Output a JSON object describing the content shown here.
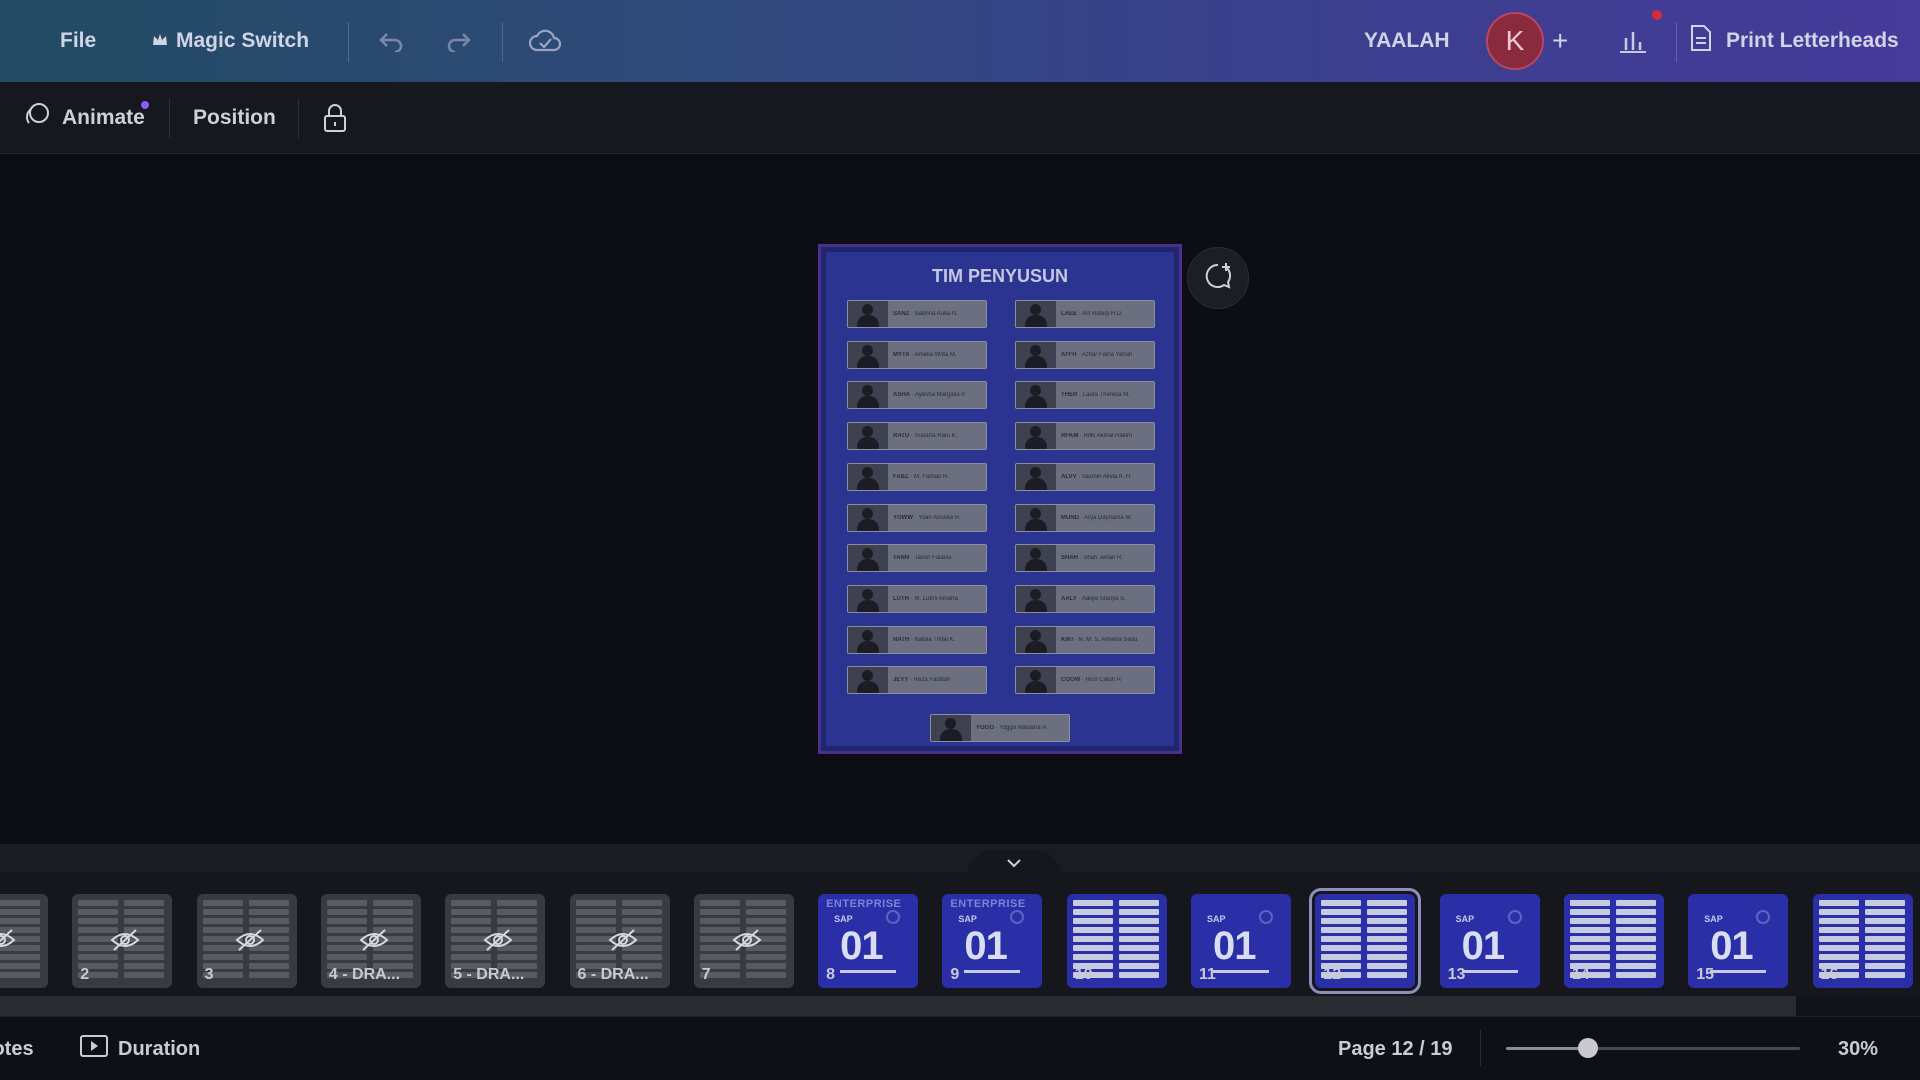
{
  "topbar": {
    "file_label": "File",
    "magic_switch_label": "Magic Switch",
    "workspace_name": "YAALAH",
    "avatar_initial": "K",
    "add_label": "+",
    "print_label": "Print Letterheads"
  },
  "toolbar": {
    "animate_label": "Animate",
    "position_label": "Position"
  },
  "page": {
    "title": "TIM PENYUSUN",
    "members": [
      {
        "code": "SANZ",
        "name": "Sabrina Aulia N."
      },
      {
        "code": "LAEE",
        "name": "Alif Rabiqi H.D."
      },
      {
        "code": "MYTA",
        "name": "Amelia Witta M."
      },
      {
        "code": "ATFH",
        "name": "Azhar Faiha Yahah"
      },
      {
        "code": "ASHA",
        "name": "Ayesha Margalia P."
      },
      {
        "code": "THER",
        "name": "Laura Theresa M."
      },
      {
        "code": "RATU",
        "name": "Sudarta Ratu K."
      },
      {
        "code": "RFKM",
        "name": "Rifki Akmal Hakim"
      },
      {
        "code": "FABZ",
        "name": "M. Farhan R."
      },
      {
        "code": "ALVV",
        "name": "Vasmin Alivia A. H."
      },
      {
        "code": "YOWW",
        "name": "Yoan Airuska R."
      },
      {
        "code": "MUND",
        "name": "Arya Daynama M."
      },
      {
        "code": "TANN",
        "name": "Tarish Falavia"
      },
      {
        "code": "SHAH",
        "name": "Shah Jehan R."
      },
      {
        "code": "LUTH",
        "name": "M. Luthfi Amarta"
      },
      {
        "code": "AALY",
        "name": "Aaliya Stanya S."
      },
      {
        "code": "NATH",
        "name": "Nabila Thifal K."
      },
      {
        "code": "KIKI",
        "name": "N. M. S. Almeria Sadu"
      },
      {
        "code": "JEYY",
        "name": "Reza Fadillah"
      },
      {
        "code": "COOW",
        "name": "Rico Caluh P."
      },
      {
        "code": "YGGO",
        "name": "Yoggo Maulana P."
      }
    ]
  },
  "filmstrip": {
    "pages": [
      {
        "label": "",
        "style": "gray-hidden"
      },
      {
        "label": "2",
        "style": "gray-hidden"
      },
      {
        "label": "3",
        "style": "gray-hidden"
      },
      {
        "label": "4 - DRA...",
        "style": "gray-hidden"
      },
      {
        "label": "5 - DRA...",
        "style": "gray-hidden"
      },
      {
        "label": "6 - DRA...",
        "style": "gray-hidden"
      },
      {
        "label": "7",
        "style": "gray-hidden"
      },
      {
        "label": "8",
        "style": "enterprise"
      },
      {
        "label": "9",
        "style": "enterprise"
      },
      {
        "label": "10",
        "style": "grid"
      },
      {
        "label": "11",
        "style": "sap"
      },
      {
        "label": "12",
        "style": "grid"
      },
      {
        "label": "13",
        "style": "sap"
      },
      {
        "label": "14",
        "style": "grid"
      },
      {
        "label": "15",
        "style": "sap"
      },
      {
        "label": "16",
        "style": "grid"
      }
    ],
    "enterprise_text": "ENTERPRISE",
    "sap_text": "SAP",
    "big_text": "01"
  },
  "bottombar": {
    "notes_label": "Notes",
    "duration_label": "Duration",
    "page_indicator": "Page 12 / 19",
    "zoom_label": "30%",
    "zoom_fraction": 0.28
  }
}
